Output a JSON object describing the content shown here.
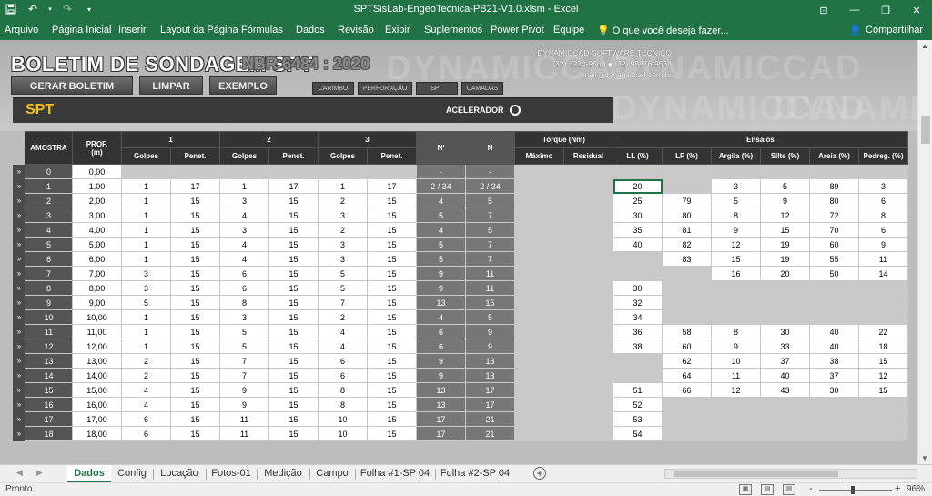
{
  "window": {
    "title": "SPTSisLab-EngeoTecnica-PB21-V1.0.xlsm - Excel",
    "controls": [
      "restore-ribbon-icon",
      "minimize-icon",
      "maximize-icon",
      "close-icon"
    ]
  },
  "menu": {
    "items": [
      "Arquivo",
      "Página Inicial",
      "Inserir",
      "Layout da Página",
      "Fórmulas",
      "Dados",
      "Revisão",
      "Exibir",
      "Suplementos",
      "Power Pivot",
      "Equipe"
    ],
    "tell_me": "O que você deseja fazer...",
    "share": "Compartilhar"
  },
  "header": {
    "title": "BOLETIM DE SONDAGEM SPT",
    "norm": "NBR 6484 : 2020",
    "watermark": "DYNAMICCAD",
    "company": "DYNAMICCAD SOFTWARE TÉCNICO",
    "phones": "(32) 3234-9568 ● (32) 98876-9568",
    "email": "mail@dynamiccad.com.br",
    "buttons": [
      "GERAR BOLETIM",
      "LIMPAR",
      "EXEMPLO"
    ],
    "small_buttons": [
      "CARIMBO",
      "PERFURAÇÃO",
      "SPT",
      "CAMADAS"
    ],
    "section": "SPT",
    "accelerator": "ACELERADOR"
  },
  "table": {
    "headers": {
      "amostra": "AMOSTRA",
      "prof": "PROF.\n(m)",
      "g1": "1",
      "g2": "2",
      "g3": "3",
      "golpes": "Golpes",
      "penet": "Penet.",
      "nprime": "N'",
      "n": "N",
      "torque": "Torque (Nm)",
      "maximo": "Máximo",
      "residual": "Residual",
      "ensaios": "Ensaios",
      "ll": "LL (%)",
      "lp": "LP (%)",
      "argila": "Argila (%)",
      "silte": "Silte (%)",
      "areia": "Areia (%)",
      "pedreg": "Pedreg. (%)"
    },
    "rows": [
      [
        "»",
        "0",
        "0,00",
        "",
        "",
        "",
        "",
        "",
        "",
        "-",
        "-",
        "",
        "",
        "",
        "",
        "",
        "",
        "",
        ""
      ],
      [
        "»",
        "1",
        "1,00",
        "1",
        "17",
        "1",
        "17",
        "1",
        "17",
        "2 / 34",
        "2 / 34",
        "",
        "",
        "20",
        "",
        "3",
        "5",
        "89",
        "3"
      ],
      [
        "»",
        "2",
        "2,00",
        "1",
        "15",
        "3",
        "15",
        "2",
        "15",
        "4",
        "5",
        "",
        "",
        "25",
        "79",
        "5",
        "9",
        "80",
        "6"
      ],
      [
        "»",
        "3",
        "3,00",
        "1",
        "15",
        "4",
        "15",
        "3",
        "15",
        "5",
        "7",
        "",
        "",
        "30",
        "80",
        "8",
        "12",
        "72",
        "8"
      ],
      [
        "»",
        "4",
        "4,00",
        "1",
        "15",
        "3",
        "15",
        "2",
        "15",
        "4",
        "5",
        "",
        "",
        "35",
        "81",
        "9",
        "15",
        "70",
        "6"
      ],
      [
        "»",
        "5",
        "5,00",
        "1",
        "15",
        "4",
        "15",
        "3",
        "15",
        "5",
        "7",
        "",
        "",
        "40",
        "82",
        "12",
        "19",
        "60",
        "9"
      ],
      [
        "»",
        "6",
        "6,00",
        "1",
        "15",
        "4",
        "15",
        "3",
        "15",
        "5",
        "7",
        "",
        "",
        "",
        "83",
        "15",
        "19",
        "55",
        "11"
      ],
      [
        "»",
        "7",
        "7,00",
        "3",
        "15",
        "6",
        "15",
        "5",
        "15",
        "9",
        "11",
        "",
        "",
        "",
        "",
        "16",
        "20",
        "50",
        "14"
      ],
      [
        "»",
        "8",
        "8,00",
        "3",
        "15",
        "6",
        "15",
        "5",
        "15",
        "9",
        "11",
        "",
        "",
        "30",
        "",
        "",
        "",
        "",
        ""
      ],
      [
        "»",
        "9",
        "9,00",
        "5",
        "15",
        "8",
        "15",
        "7",
        "15",
        "13",
        "15",
        "",
        "",
        "32",
        "",
        "",
        "",
        "",
        ""
      ],
      [
        "»",
        "10",
        "10,00",
        "1",
        "15",
        "3",
        "15",
        "2",
        "15",
        "4",
        "5",
        "",
        "",
        "34",
        "",
        "",
        "",
        "",
        ""
      ],
      [
        "»",
        "11",
        "11,00",
        "1",
        "15",
        "5",
        "15",
        "4",
        "15",
        "6",
        "9",
        "",
        "",
        "36",
        "58",
        "8",
        "30",
        "40",
        "22"
      ],
      [
        "»",
        "12",
        "12,00",
        "1",
        "15",
        "5",
        "15",
        "4",
        "15",
        "6",
        "9",
        "",
        "",
        "38",
        "60",
        "9",
        "33",
        "40",
        "18"
      ],
      [
        "»",
        "13",
        "13,00",
        "2",
        "15",
        "7",
        "15",
        "6",
        "15",
        "9",
        "13",
        "",
        "",
        "",
        "62",
        "10",
        "37",
        "38",
        "15"
      ],
      [
        "»",
        "14",
        "14,00",
        "2",
        "15",
        "7",
        "15",
        "6",
        "15",
        "9",
        "13",
        "",
        "",
        "",
        "64",
        "11",
        "40",
        "37",
        "12"
      ],
      [
        "»",
        "15",
        "15,00",
        "4",
        "15",
        "9",
        "15",
        "8",
        "15",
        "13",
        "17",
        "",
        "",
        "51",
        "66",
        "12",
        "43",
        "30",
        "15"
      ],
      [
        "»",
        "16",
        "16,00",
        "4",
        "15",
        "9",
        "15",
        "8",
        "15",
        "13",
        "17",
        "",
        "",
        "52",
        "",
        "",
        "",
        "",
        ""
      ],
      [
        "»",
        "17",
        "17,00",
        "6",
        "15",
        "11",
        "15",
        "10",
        "15",
        "17",
        "21",
        "",
        "",
        "53",
        "",
        "",
        "",
        "",
        ""
      ],
      [
        "»",
        "18",
        "18,00",
        "6",
        "15",
        "11",
        "15",
        "10",
        "15",
        "17",
        "21",
        "",
        "",
        "54",
        "",
        "",
        "",
        "",
        ""
      ]
    ]
  },
  "tabs": [
    "Dados",
    "Config",
    "Locação",
    "Fotos-01",
    "Medição",
    "Campo",
    "Folha #1-SP 04",
    "Folha #2-SP 04"
  ],
  "active_tab": "Dados",
  "status": {
    "ready": "Pronto",
    "zoom": "96%",
    "minus": "-",
    "plus": "+"
  },
  "colors": {
    "excel_green": "#217346",
    "spt_yellow": "#f0c020"
  }
}
